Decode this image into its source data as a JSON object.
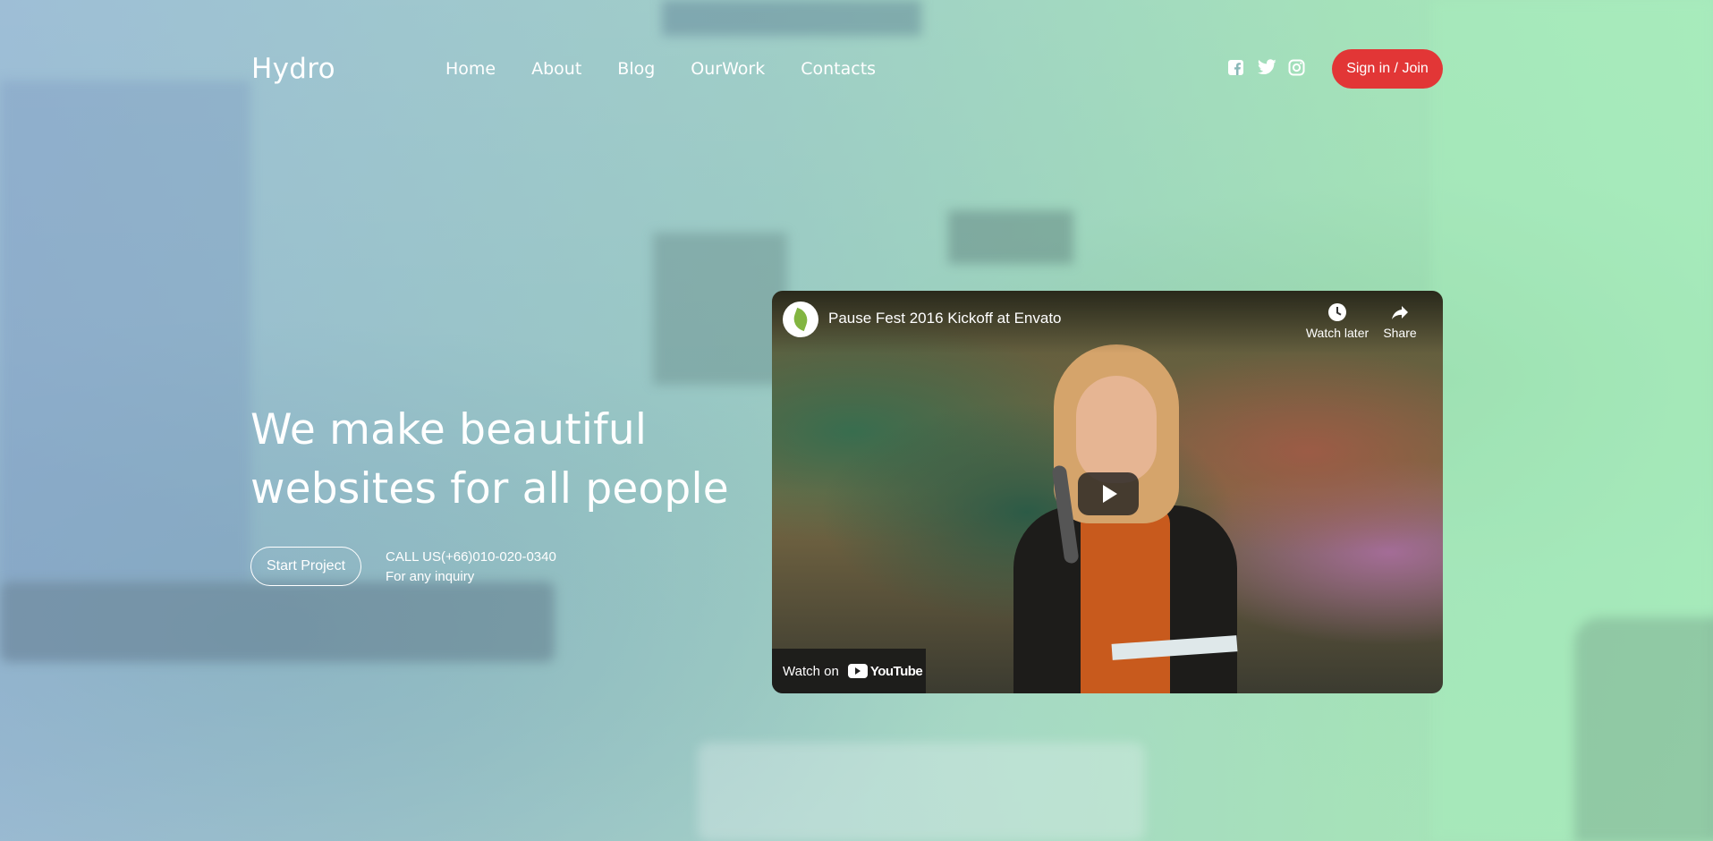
{
  "header": {
    "logo": "Hydro",
    "nav": [
      "Home",
      "About",
      "Blog",
      "OurWork",
      "Contacts"
    ],
    "social_icons": [
      "facebook-icon",
      "twitter-icon",
      "instagram-icon"
    ],
    "signin_label": "Sign in / Join",
    "signin_color": "#e23636"
  },
  "hero": {
    "headline_line1": "We make beautiful",
    "headline_line2": "websites for all people",
    "cta_label": "Start Project",
    "call_text": "CALL US(+66)010-020-0340",
    "inquiry_text": "For any inquiry"
  },
  "video": {
    "title": "Pause Fest 2016 Kickoff at Envato",
    "watch_later_label": "Watch later",
    "share_label": "Share",
    "watch_on_label": "Watch on",
    "platform": "YouTube"
  }
}
